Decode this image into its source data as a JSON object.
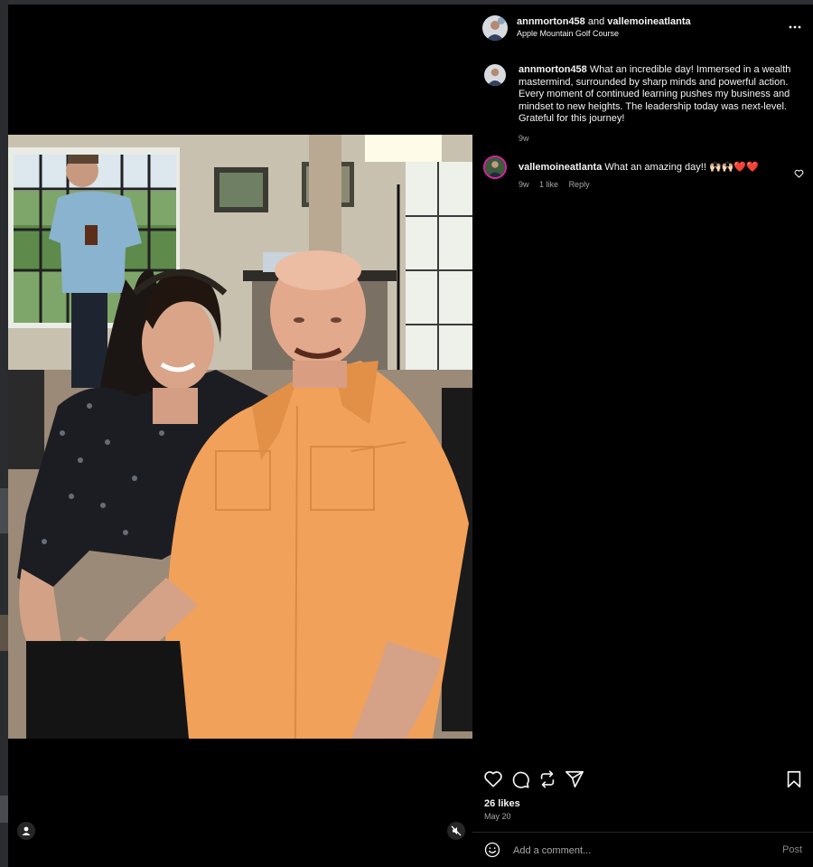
{
  "post": {
    "author": "annmorton458",
    "joiner": "and",
    "collaborator": "vallemoineatlanta",
    "location": "Apple Mountain Golf Course"
  },
  "caption": {
    "username": "annmorton458",
    "text": "What an incredible day! Immersed in a wealth mastermind, surrounded by sharp minds and powerful action. Every moment of continued learning pushes my business and mindset to new heights. The leadership today was next-level. Grateful for this journey!",
    "time": "9w"
  },
  "comments": [
    {
      "username": "vallemoineatlanta",
      "text": "What an amazing day!! 🙌🏻🙌🏻❤️❤️",
      "time": "9w",
      "likes": "1 like",
      "reply": "Reply"
    }
  ],
  "engagement": {
    "likes": "26 likes",
    "date": "May 20"
  },
  "comment_box": {
    "placeholder": "Add a comment...",
    "post_label": "Post"
  },
  "icons": {
    "like": "heart-icon",
    "comment": "comment-icon",
    "repost": "repost-icon",
    "share": "share-icon",
    "save": "bookmark-icon",
    "more": "more-icon",
    "user_tag": "user-icon",
    "mute": "mute-icon",
    "emoji": "emoji-icon"
  },
  "colors": {
    "background": "#000000",
    "text": "#f5f5f5",
    "secondary_text": "#a8a8a8",
    "shirt": "#f1a15a"
  }
}
